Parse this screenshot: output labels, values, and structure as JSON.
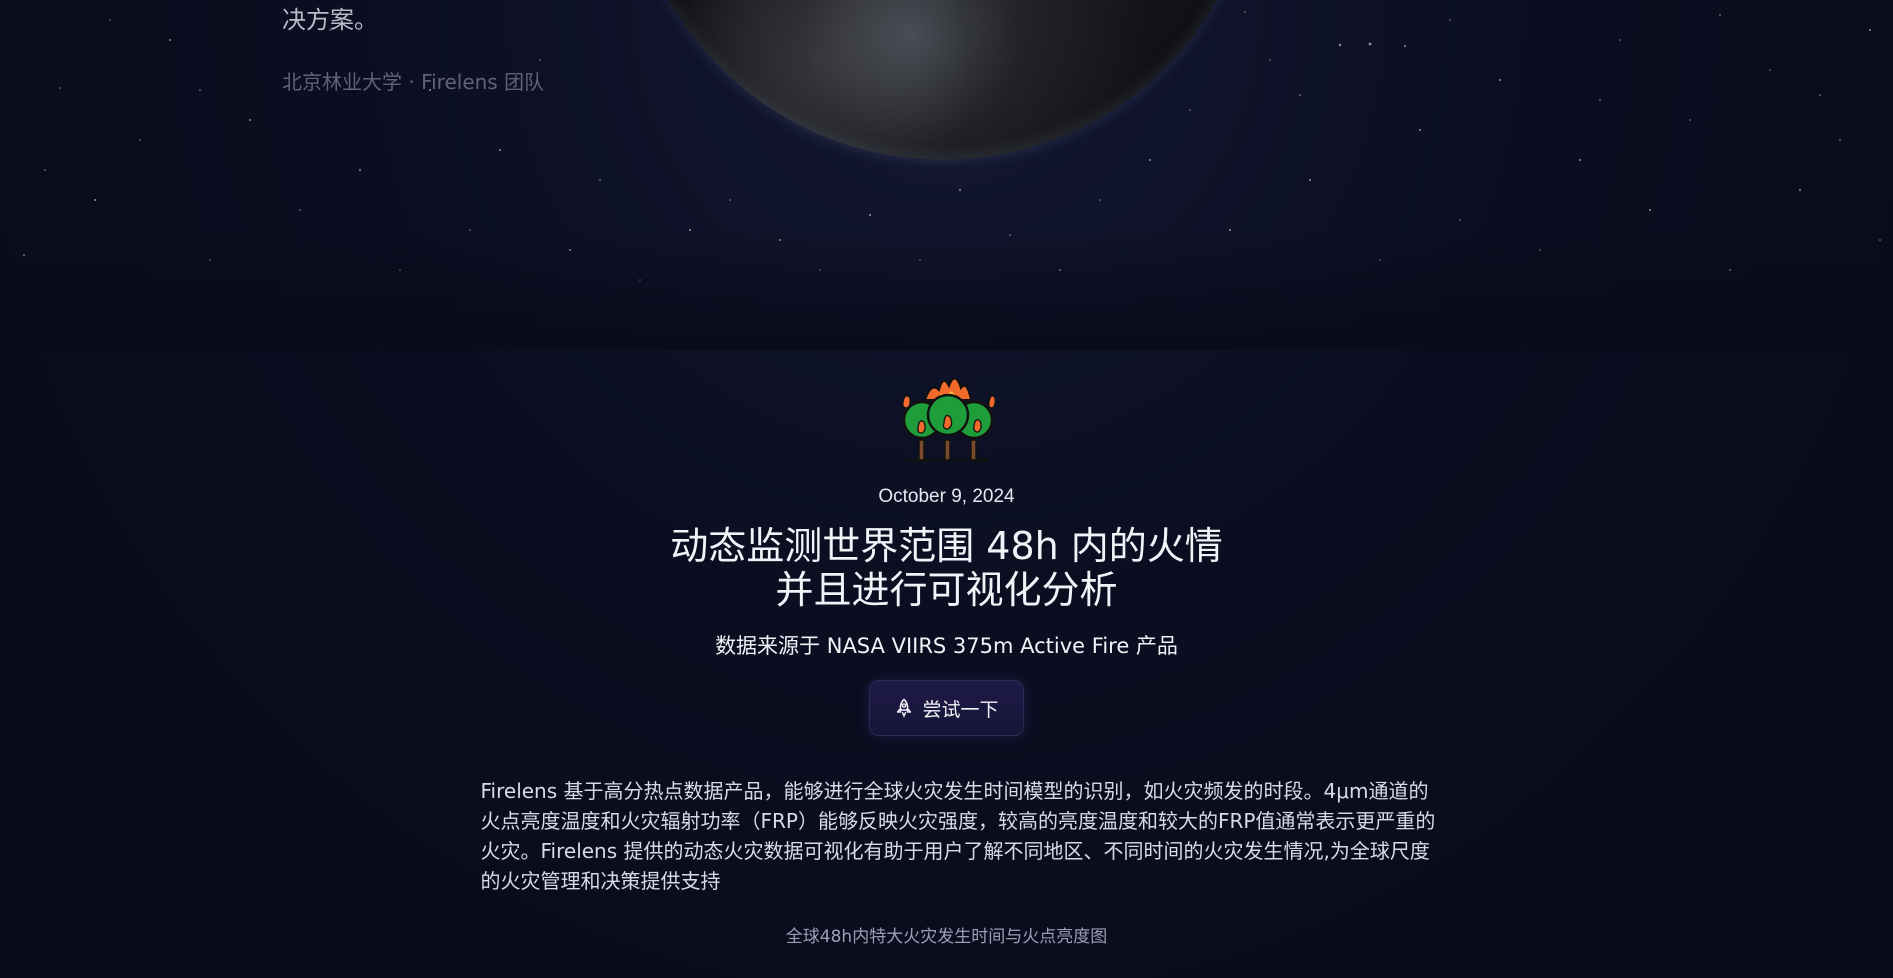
{
  "hero": {
    "text_tail": "决方案。",
    "credit": "北京林业大学 · Firelens 团队"
  },
  "icons": {
    "fire": "forest-fire-icon",
    "rocket": "rocket-icon"
  },
  "article": {
    "date": "October 9, 2024",
    "title_line1": "动态监测世界范围 48h 内的火情",
    "title_line2": "并且进行可视化分析",
    "subtitle": "数据来源于 NASA VIIRS 375m Active Fire 产品",
    "cta_label": "尝试一下",
    "description": "Firelens 基于高分热点数据产品，能够进行全球火灾发生时间模型的识别，如火灾频发的时段。4μm通道的火点亮度温度和火灾辐射功率（FRP）能够反映火灾强度，较高的亮度温度和较大的FRP值通常表示更严重的火灾。Firelens 提供的动态火灾数据可视化有助于用户了解不同地区、不同时间的火灾发生情况,为全球尺度的火灾管理和决策提供支持",
    "figure_caption": "全球48h内特大火灾发生时间与火点亮度图"
  },
  "colors": {
    "background": "#0a0d1e",
    "button_bg": "#1e1a48",
    "tree_green": "#1f9d3a",
    "flame_orange": "#f26b2a"
  }
}
